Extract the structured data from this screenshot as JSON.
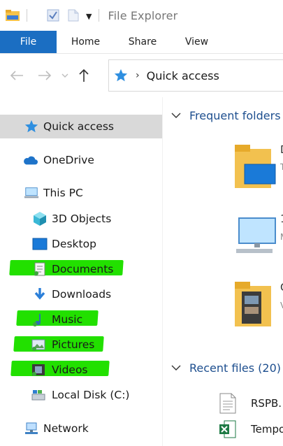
{
  "window": {
    "title": "File Explorer"
  },
  "ribbon": {
    "tabs": [
      "File",
      "Home",
      "Share",
      "View"
    ]
  },
  "address": {
    "path": "Quick access"
  },
  "navpane": {
    "items": [
      {
        "label": "Quick access"
      },
      {
        "label": "OneDrive"
      },
      {
        "label": "This PC"
      },
      {
        "label": "3D Objects"
      },
      {
        "label": "Desktop"
      },
      {
        "label": "Documents"
      },
      {
        "label": "Downloads"
      },
      {
        "label": "Music"
      },
      {
        "label": "Pictures"
      },
      {
        "label": "Videos"
      },
      {
        "label": "Local Disk (C:)"
      },
      {
        "label": "Network"
      }
    ]
  },
  "content": {
    "frequent_header": "Frequent folders",
    "frequent_items": [
      {
        "title": "D",
        "sub": "T"
      },
      {
        "title": "1",
        "sub": "M"
      },
      {
        "title": "C",
        "sub": "V"
      }
    ],
    "recent_header": "Recent files (20)",
    "recent_files": [
      {
        "name": "RSPB."
      },
      {
        "name": "Tempo"
      }
    ]
  },
  "colors": {
    "accent": "#1b6ec2",
    "selection": "#d9d9d9",
    "highlight_marker": "#22e000",
    "section_header": "#1e4f8f"
  }
}
